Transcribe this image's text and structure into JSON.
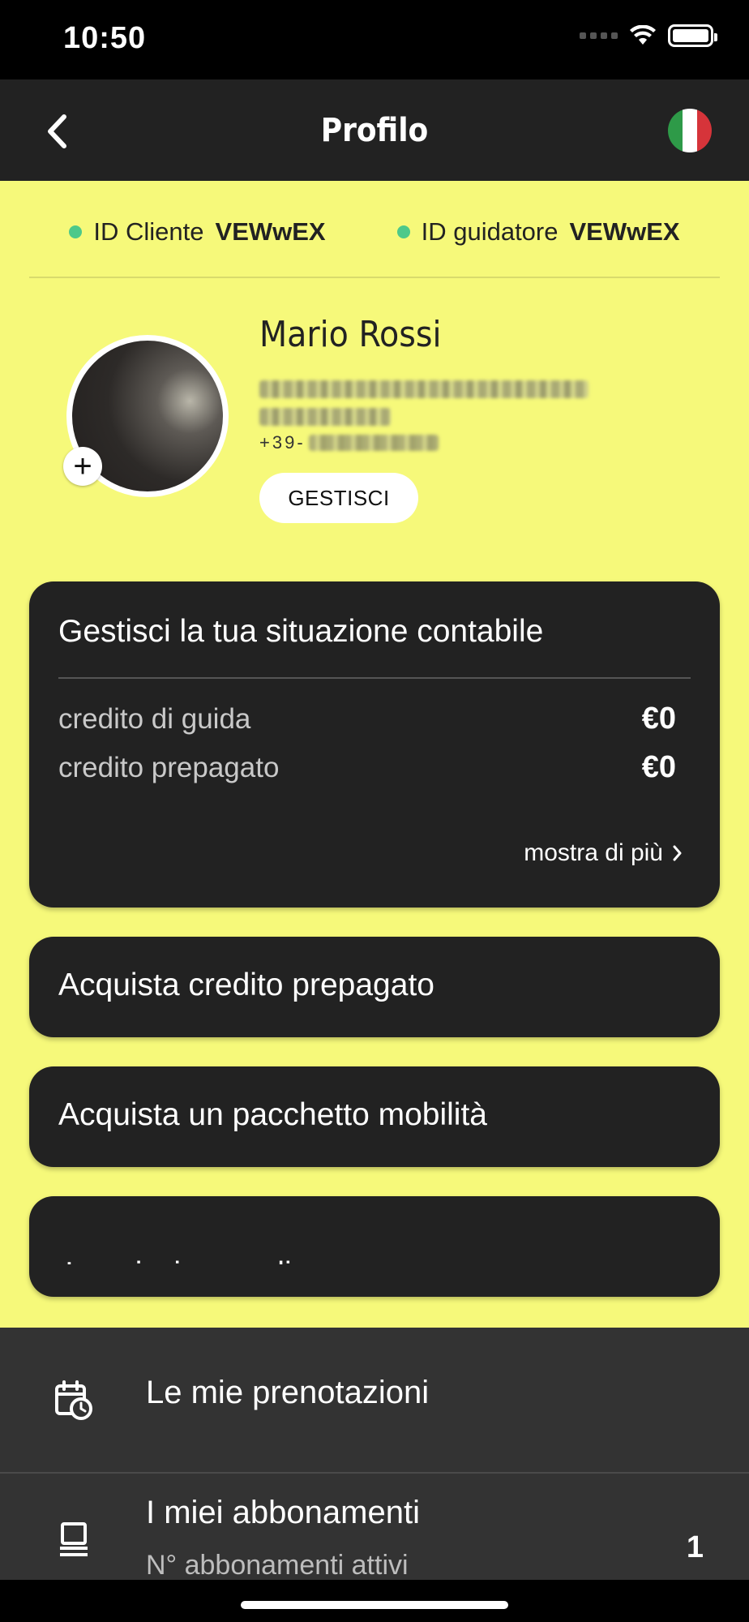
{
  "status_bar": {
    "time": "10:50"
  },
  "nav": {
    "title": "Profilo",
    "flag_colors": [
      "#2e9a48",
      "#ffffff",
      "#d6343a"
    ]
  },
  "ids": {
    "client_label": "ID Cliente",
    "client_value": "VEWwEX",
    "driver_label": "ID guidatore",
    "driver_value": "VEWwEX"
  },
  "profile": {
    "name": "Mario Rossi",
    "phone_prefix": "+39-",
    "manage_label": "GESTISCI"
  },
  "account": {
    "title": "Gestisci la tua situazione contabile",
    "rows": [
      {
        "label": "credito di guida",
        "value": "€0"
      },
      {
        "label": "credito prepagato",
        "value": "€0"
      }
    ],
    "more_label": "mostra di più"
  },
  "actions": [
    "Acquista credito prepagato",
    "Acquista un pacchetto mobilità",
    "Inserisci un codice coupon"
  ],
  "menu": {
    "bookings": {
      "label": "Le mie prenotazioni",
      "icon": "calendar-clock-icon"
    },
    "subscriptions": {
      "label": "I miei abbonamenti",
      "sublabel": "N° abbonamenti attivi",
      "count": "1",
      "icon": "laptop-icon"
    }
  },
  "colors": {
    "yellow": "#f6f97a",
    "dark": "#222222",
    "accent_dot": "#4dc98a"
  }
}
